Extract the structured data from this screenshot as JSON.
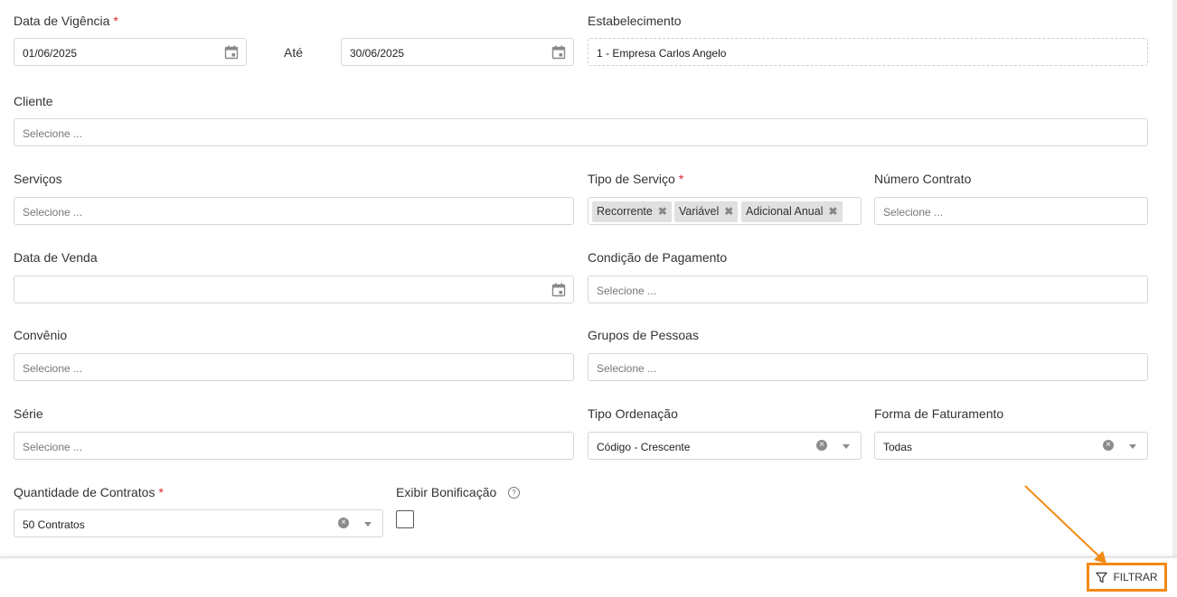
{
  "form": {
    "vigencia": {
      "label": "Data de Vigência",
      "required_mark": "*",
      "from": "01/06/2025",
      "until_label": "Até",
      "to": "30/06/2025"
    },
    "estabelecimento": {
      "label": "Estabelecimento",
      "value": "1 - Empresa Carlos Angelo"
    },
    "cliente": {
      "label": "Cliente",
      "placeholder": "Selecione ..."
    },
    "servicos": {
      "label": "Serviços",
      "placeholder": "Selecione ..."
    },
    "tipo_servico": {
      "label": "Tipo de Serviço",
      "required_mark": "*",
      "tags": [
        "Recorrente",
        "Variável",
        "Adicional Anual"
      ],
      "remove_glyph": "✖"
    },
    "numero_contrato": {
      "label": "Número Contrato",
      "placeholder": "Selecione ..."
    },
    "data_venda": {
      "label": "Data de Venda",
      "value": ""
    },
    "condicao_pagamento": {
      "label": "Condição de Pagamento",
      "placeholder": "Selecione ..."
    },
    "convenio": {
      "label": "Convênio",
      "placeholder": "Selecione ..."
    },
    "grupos_pessoas": {
      "label": "Grupos de Pessoas",
      "placeholder": "Selecione ..."
    },
    "serie": {
      "label": "Série",
      "placeholder": "Selecione ..."
    },
    "tipo_ordenacao": {
      "label": "Tipo Ordenação",
      "value": "Código - Crescente"
    },
    "forma_faturamento": {
      "label": "Forma de Faturamento",
      "value": "Todas"
    },
    "quantidade_contratos": {
      "label": "Quantidade de Contratos",
      "required_mark": "*",
      "value": "50 Contratos"
    },
    "exibir_bonificacao": {
      "label": "Exibir Bonificação",
      "checked": false,
      "help_glyph": "?"
    }
  },
  "footer": {
    "filter_label": "FILTRAR"
  },
  "colors": {
    "required": "#d62828",
    "highlight": "#f28a16",
    "border": "#d7d7d7"
  },
  "icons": {
    "calendar": "calendar-icon",
    "clear": "clear-icon",
    "dropdown": "chevron-down-icon",
    "filter": "filter-icon",
    "help": "help-icon"
  }
}
